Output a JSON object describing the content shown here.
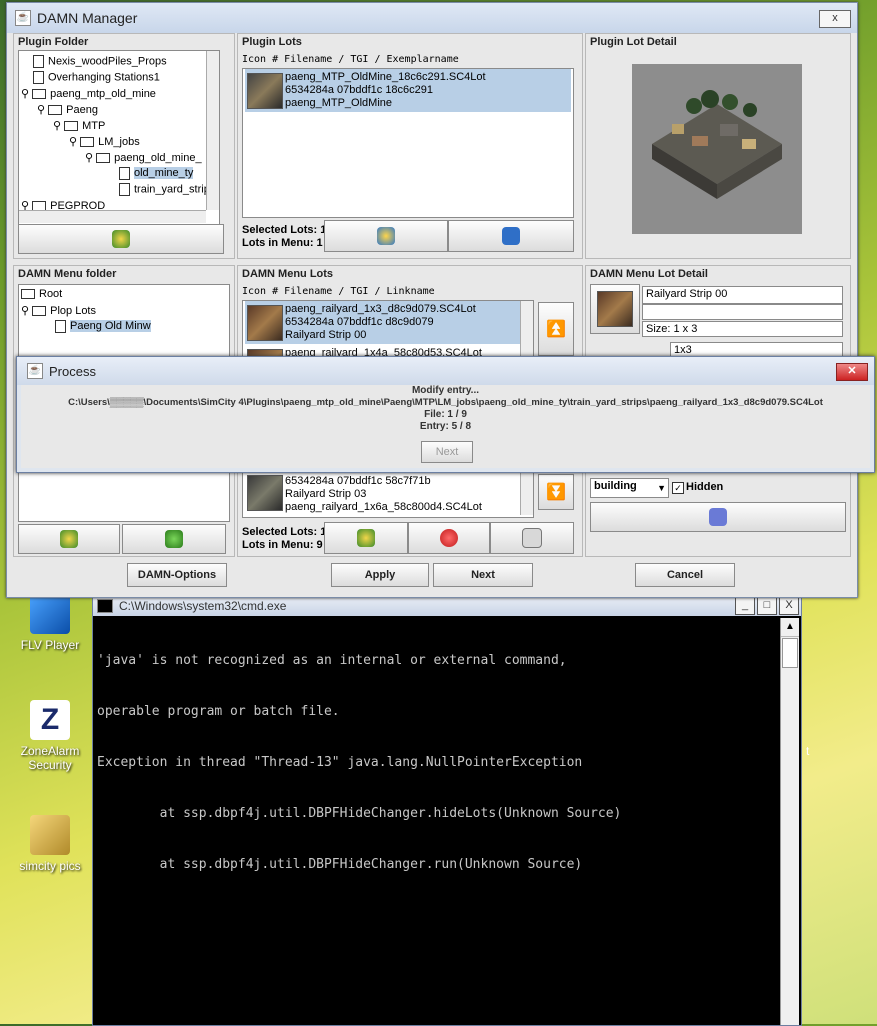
{
  "window": {
    "title": "DAMN Manager",
    "close": "x"
  },
  "plugin_folder": {
    "title": "Plugin Folder",
    "items": [
      "Nexis_woodPiles_Props",
      "Overhanging Stations1",
      "paeng_mtp_old_mine",
      "Paeng",
      "MTP",
      "LM_jobs",
      "paeng_old_mine_",
      "old_mine_ty",
      "train_yard_strip",
      "PEGPROD"
    ]
  },
  "plugin_lots": {
    "title": "Plugin Lots",
    "header": "Icon # Filename / TGI / Exemplarname",
    "rows": [
      {
        "line1": "paeng_MTP_OldMine_18c6c291.SC4Lot",
        "line2": "6534284a 07bddf1c 18c6c291",
        "line3": "paeng_MTP_OldMine"
      }
    ],
    "selected": "Selected Lots: 1",
    "in_menu": "Lots in Menu: 1"
  },
  "plugin_lot_detail": {
    "title": "Plugin Lot Detail"
  },
  "menu_folder": {
    "title": "DAMN Menu folder",
    "items": [
      "Root",
      "Plop Lots",
      "Paeng Old Minw"
    ]
  },
  "menu_lots": {
    "title": "DAMN Menu Lots",
    "header": "Icon # Filename / TGI / Linkname",
    "rows": [
      {
        "line1": "paeng_railyard_1x3_d8c9d079.SC4Lot",
        "line2": "6534284a 07bddf1c d8c9d079",
        "line3": "Railyard Strip 00"
      },
      {
        "line1": "paeng_railyard_1x4a_58c80d53.SC4Lot",
        "line2": "",
        "line3": ""
      }
    ],
    "rows_bottom": [
      {
        "line1": "6534284a 07bddf1c 58c7f71b",
        "line2": "Railyard Strip 03",
        "line3": "paeng_railyard_1x6a_58c800d4.SC4Lot"
      }
    ],
    "selected": "Selected Lots: 1",
    "in_menu": "Lots in Menu: 9"
  },
  "menu_lot_detail": {
    "title": "DAMN Menu Lot Detail",
    "name": "Railyard Strip 00",
    "size": "Size: 1 x 3",
    "list_item": "1x3",
    "type": "building",
    "hidden_label": "Hidden"
  },
  "buttons": {
    "options": "DAMN-Options",
    "apply": "Apply",
    "next": "Next",
    "cancel": "Cancel"
  },
  "process": {
    "title": "Process",
    "line1": "Modify entry...",
    "path": "C:\\Users\\▒▒▒▒▒\\Documents\\SimCity 4\\Plugins\\paeng_mtp_old_mine\\Paeng\\MTP\\LM_jobs\\paeng_old_mine_ty\\train_yard_strips\\paeng_railyard_1x3_d8c9d079.SC4Lot",
    "file": "File: 1 / 9",
    "entry": "Entry: 5 / 8",
    "next": "Next"
  },
  "desktop": {
    "icons": [
      "FLV Player",
      "ZoneAlarm Security",
      "simcity pics"
    ]
  },
  "cmd": {
    "title": "C:\\Windows\\system32\\cmd.exe",
    "lines": [
      "'java' is not recognized as an internal or external command,",
      "operable program or batch file.",
      "Exception in thread \"Thread-13\" java.lang.NullPointerException",
      "        at ssp.dbpf4j.util.DBPFHideChanger.hideLots(Unknown Source)",
      "        at ssp.dbpf4j.util.DBPFHideChanger.run(Unknown Source)"
    ],
    "minimize": "_",
    "maximize": "□",
    "close": "X"
  },
  "colors": {
    "selection": "#b8cfe6",
    "title_bar": "#c8d6ea",
    "cmd_bg": "#000000"
  }
}
